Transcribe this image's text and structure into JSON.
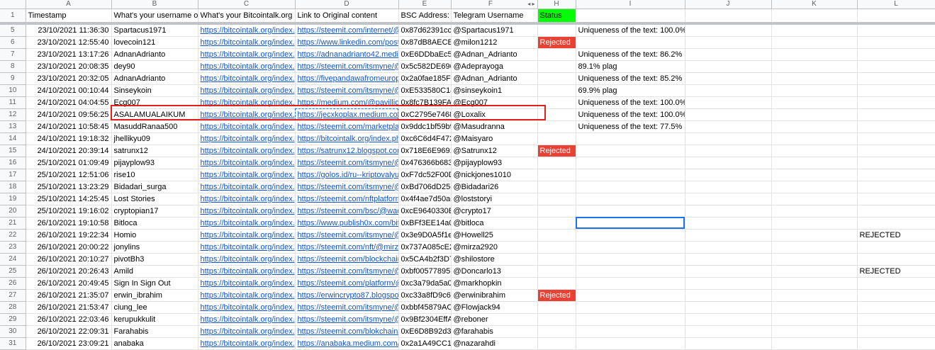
{
  "columns": [
    {
      "letter": "",
      "width": 36
    },
    {
      "letter": "A",
      "width": 121
    },
    {
      "letter": "B",
      "width": 122
    },
    {
      "letter": "C",
      "width": 137
    },
    {
      "letter": "D",
      "width": 146
    },
    {
      "letter": "E",
      "width": 74
    },
    {
      "letter": "F",
      "width": 122
    },
    {
      "letter": "H",
      "width": 54
    },
    {
      "letter": "I",
      "width": 154
    },
    {
      "letter": "J",
      "width": 122
    },
    {
      "letter": "K",
      "width": 121
    },
    {
      "letter": "L",
      "width": 110
    }
  ],
  "col_arrow_glyph": "◂ ▸",
  "header_row": {
    "num": "1",
    "cells": [
      "Timestamp",
      "What's your username on",
      "What's your Bitcointalk.org p",
      "Link to Original content",
      "BSC Address:",
      "Telegram Username",
      "Status",
      "",
      "",
      "",
      ""
    ]
  },
  "rows": [
    {
      "num": "5",
      "ts": "23/10/2021 11:36:30",
      "user": "Spartacus1971",
      "btt": "https://bitcointalk.org/index.p",
      "link": "https://steemit.com/internet/@",
      "bsc": "0x87d62391cce",
      "tg": "@Spartacus1971",
      "status": "",
      "note": "Uniqueness of the text: 100.0%",
      "l": ""
    },
    {
      "num": "6",
      "ts": "23/10/2021 12:55:40",
      "user": "lovecoin121",
      "btt": "https://bitcointalk.org/index.p",
      "link": "https://www.linkedin.com/posts",
      "bsc": "0x87dB8AECB",
      "tg": "@milon1212",
      "status": "Rejected",
      "note": "",
      "l": ""
    },
    {
      "num": "7",
      "ts": "23/10/2021 13:17:26",
      "user": "AdnanAdrianto",
      "btt": "https://bitcointalk.org/index.p",
      "link": "https://adnanadrianto42.mediu",
      "bsc": "0xE6DDbaEc5I",
      "tg": "@Adnan_Adrianto",
      "status": "",
      "note": "Uniqueness of the text: 86.2%",
      "l": ""
    },
    {
      "num": "8",
      "ts": "23/10/2021 20:08:35",
      "user": "dey90",
      "btt": "https://bitcointalk.org/index.p",
      "link": "https://steemit.com/itsmyne/@",
      "bsc": "0x5c582DE696",
      "tg": "@Adeprayoga",
      "status": "",
      "note": "89.1% plag",
      "l": ""
    },
    {
      "num": "9",
      "ts": "23/10/2021 20:32:05",
      "user": "AdnanAdrianto",
      "btt": "https://bitcointalk.org/index.p",
      "link": "https://fivepandawafromeurope",
      "bsc": "0x2a0fae185F4",
      "tg": "@Adnan_Adrianto",
      "status": "",
      "note": "Uniqueness of the text: 85.2%",
      "l": ""
    },
    {
      "num": "10",
      "ts": "24/10/2021 00:10:44",
      "user": "Sinseykoin",
      "btt": "https://bitcointalk.org/index.p",
      "link": "https://steemit.com/itsmyne/@",
      "bsc": "0xE533580C14",
      "tg": "@sinseykoin1",
      "status": "",
      "note": "69.9% plag",
      "l": ""
    },
    {
      "num": "11",
      "ts": "24/10/2021 04:04:55",
      "user": "Ecg007",
      "btt": "https://bitcointalk.org/index.p",
      "link": "https://medium.com/@pavillion",
      "bsc": "0x8fc7B139FAE",
      "tg": "@Ecg007",
      "status": "",
      "note": "Uniqueness of the text: 100.0%",
      "l": ""
    },
    {
      "num": "12",
      "ts": "24/10/2021 09:56:25",
      "user": "ASALAMUALAIKUM",
      "btt": "https://bitcointalk.org/index.p",
      "link": "https://jecxkoplax.medium.com",
      "bsc": "0xC2795e7468",
      "tg": "@Loxalix",
      "status": "",
      "note": "Uniqueness of the text: 100.0%",
      "l": ""
    },
    {
      "num": "13",
      "ts": "24/10/2021 10:58:45",
      "user": "MasuddRanaa500",
      "btt": "https://bitcointalk.org/index.p",
      "link": "https://steemit.com/marketplac",
      "bsc": "0x9ddc1bf59b9",
      "tg": "@Masudranna",
      "status": "",
      "note": "Uniqueness of the text: 77.5%",
      "l": ""
    },
    {
      "num": "14",
      "ts": "24/10/2021 19:18:32",
      "user": "jhellikyu09",
      "btt": "https://bitcointalk.org/index.p",
      "link": "https://bitcointalk.org/index.php",
      "bsc": "0xc6C6d4F472",
      "tg": "@Maisyaro",
      "status": "",
      "note": "",
      "l": ""
    },
    {
      "num": "15",
      "ts": "24/10/2021 20:39:14",
      "user": "satrunx12",
      "btt": "https://bitcointalk.org/index.p",
      "link": "https://satrunx12.blogspot.com",
      "bsc": "0x718E6E9691",
      "tg": "@Satrunx12",
      "status": "Rejected",
      "note": "",
      "l": ""
    },
    {
      "num": "16",
      "ts": "25/10/2021 01:09:49",
      "user": "pijayplow93",
      "btt": "https://bitcointalk.org/index.p",
      "link": "https://steemit.com/itsmyne/@",
      "bsc": "0x476366b683",
      "tg": "@pijayplow93",
      "status": "",
      "note": "",
      "l": ""
    },
    {
      "num": "17",
      "ts": "25/10/2021 12:51:06",
      "user": "rise10",
      "btt": "https://bitcointalk.org/index.p",
      "link": "https://golos.id/ru--kriptovalyut",
      "bsc": "0xF7dc52F00D",
      "tg": "@nickjones1010",
      "status": "",
      "note": "",
      "l": ""
    },
    {
      "num": "18",
      "ts": "25/10/2021 13:23:29",
      "user": "Bidadari_surga",
      "btt": "https://bitcointalk.org/index.p",
      "link": "https://steemit.com/itsmyne/@",
      "bsc": "0xBd706dD25c",
      "tg": "@Bidadari26",
      "status": "",
      "note": "",
      "l": ""
    },
    {
      "num": "19",
      "ts": "25/10/2021 14:25:45",
      "user": "Lost Stories",
      "btt": "https://bitcointalk.org/index.p",
      "link": "https://steemit.com/nftplatform",
      "bsc": "0x4f4ae7d50ac",
      "tg": "@loststoryi",
      "status": "",
      "note": "",
      "l": ""
    },
    {
      "num": "20",
      "ts": "25/10/2021 19:16:02",
      "user": "cryptopian17",
      "btt": " https://bitcointalk.org/index.p",
      "link": "https://steemit.com/bsc/@waq",
      "bsc": "0xcE9640330E",
      "tg": "@crypto17",
      "status": "",
      "note": "",
      "l": ""
    },
    {
      "num": "21",
      "ts": "26/10/2021 19:10:58",
      "user": "Bitloca",
      "btt": "https://bitcointalk.org/index.p",
      "link": "https://www.publish0x.com/bitl",
      "bsc": "0xBFf3EE14a0",
      "tg": "@bitloca",
      "status": "",
      "note": "",
      "l": ""
    },
    {
      "num": "22",
      "ts": "26/10/2021 19:22:34",
      "user": "Homio",
      "btt": "https://bitcointalk.org/index.p",
      "link": "https://steemit.com/itsmyne/@",
      "bsc": "0x3e9D0A5f1e",
      "tg": "@Howell25",
      "status": "",
      "note": "",
      "l": "REJECTED"
    },
    {
      "num": "23",
      "ts": "26/10/2021 20:00:22",
      "user": "jonylins",
      "btt": "https://bitcointalk.org/index.p",
      "link": "https://steemit.com/nft/@mirza",
      "bsc": "0x737A085cE2",
      "tg": "@mirza2920",
      "status": "",
      "note": "",
      "l": ""
    },
    {
      "num": "24",
      "ts": "26/10/2021 20:10:27",
      "user": "pivotBh3",
      "btt": "https://bitcointalk.org/index.p",
      "link": "https://steemit.com/blockchain",
      "bsc": "0x5CA4b2f3D7",
      "tg": "@shilostore",
      "status": "",
      "note": "",
      "l": ""
    },
    {
      "num": "25",
      "ts": "26/10/2021 20:26:43",
      "user": "Amild",
      "btt": "https://bitcointalk.org/index.p",
      "link": "https://steemit.com/itsmyne/@",
      "bsc": "0xbf005778957",
      "tg": "@Doncarlo13",
      "status": "",
      "note": "",
      "l": "REJECTED"
    },
    {
      "num": "26",
      "ts": "26/10/2021 20:49:45",
      "user": "Sign In Sign Out",
      "btt": "https://bitcointalk.org/index.p",
      "link": "https://steemit.com/platform/@",
      "bsc": "0xc3a79da5a0",
      "tg": "@markhopkin",
      "status": "",
      "note": "",
      "l": ""
    },
    {
      "num": "27",
      "ts": "26/10/2021 21:35:07",
      "user": "erwin_ibrahim",
      "btt": "https://bitcointalk.org/index.p",
      "link": "https://erwincrypto87.blogspot",
      "bsc": "0xc33a8fD9c68",
      "tg": "@erwinibrahim",
      "status": "Rejected",
      "note": "",
      "l": ""
    },
    {
      "num": "28",
      "ts": "26/10/2021 21:53:47",
      "user": "ciung_lee",
      "btt": "https://bitcointalk.org/index.p",
      "link": "https://steemit.com/itsmyne/@",
      "bsc": "0xbbf45879AC",
      "tg": "@Flowjack94",
      "status": "",
      "note": "",
      "l": ""
    },
    {
      "num": "29",
      "ts": "26/10/2021 22:03:46",
      "user": "kerupukkulit",
      "btt": "https://bitcointalk.org/index.p",
      "link": "https://steemit.com/itsmyne/@",
      "bsc": "0x9Bf2304EffA",
      "tg": "@reboner",
      "status": "",
      "note": "",
      "l": ""
    },
    {
      "num": "30",
      "ts": "26/10/2021 22:09:31",
      "user": "Farahabis",
      "btt": "https://bitcointalk.org/index.p",
      "link": "https://steemit.com/blokchain/@",
      "bsc": "0xE6D8B92d35",
      "tg": "@farahabis",
      "status": "",
      "note": "",
      "l": ""
    },
    {
      "num": "31",
      "ts": "26/10/2021 23:09:21",
      "user": "anabaka",
      "btt": "https://bitcointalk.org/index.p",
      "link": "https://anabaka.medium.com/i",
      "bsc": "0x2a1A49CC12",
      "tg": "@nazarahdi",
      "status": "",
      "note": "",
      "l": ""
    }
  ],
  "colors": {
    "rejected": "#e94235",
    "status_header": "#00ff00",
    "link": "#1155cc",
    "highlight_box": "#e0201c",
    "selection": "#1a73e8"
  }
}
